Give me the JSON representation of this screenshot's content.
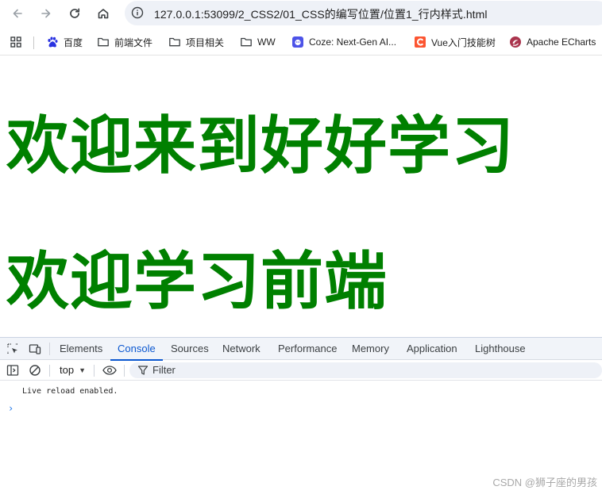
{
  "browser": {
    "url": "127.0.0.1:53099/2_CSS2/01_CSS的编写位置/位置1_行内样式.html",
    "icons": {
      "back": "arrow-left-icon",
      "forward": "arrow-right-icon",
      "reload": "reload-icon",
      "home": "home-icon",
      "info": "info-icon"
    }
  },
  "bookmarks": {
    "apps_icon": "apps-grid-icon",
    "items": [
      {
        "label": "百度",
        "icon": "baidu-paw-icon"
      },
      {
        "label": "前端文件",
        "icon": "folder-icon"
      },
      {
        "label": "项目相关",
        "icon": "folder-icon"
      },
      {
        "label": "WW",
        "icon": "folder-icon"
      },
      {
        "label": "Coze: Next-Gen AI...",
        "icon": "coze-icon"
      },
      {
        "label": "Vue入门技能树",
        "icon": "csdn-icon"
      },
      {
        "label": "Apache ECharts",
        "icon": "echarts-icon"
      }
    ]
  },
  "page": {
    "line1": "欢迎来到好好学习",
    "line2": "欢迎学习前端",
    "text_color": "#008000"
  },
  "devtools": {
    "tabs": [
      "Elements",
      "Console",
      "Sources",
      "Network",
      "Performance",
      "Memory",
      "Application",
      "Lighthouse"
    ],
    "active_tab": "Console",
    "context": "top",
    "filter_placeholder": "Filter",
    "log": "Live reload enabled.",
    "prompt": "›"
  },
  "watermark": "CSDN @狮子座的男孩"
}
